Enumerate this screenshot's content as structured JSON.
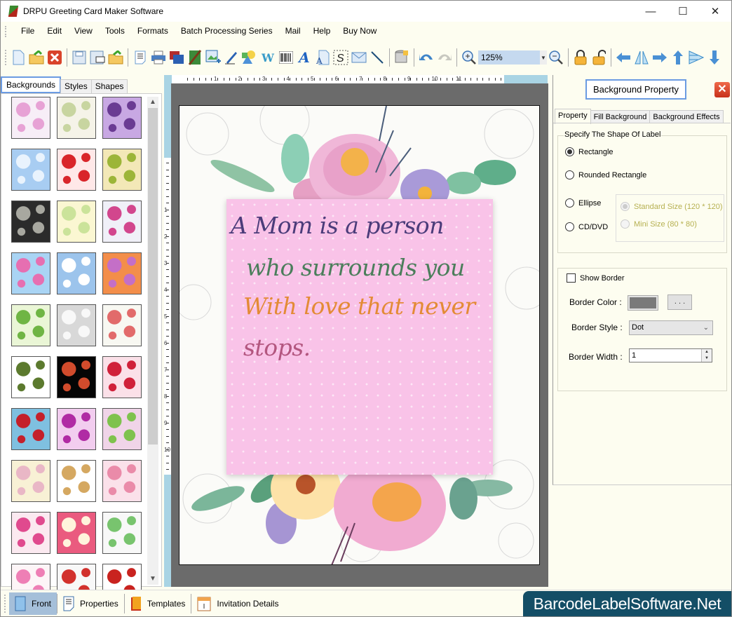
{
  "window": {
    "title": "DRPU Greeting Card Maker Software",
    "controls": {
      "minimize": "—",
      "maximize": "☐",
      "close": "✕"
    }
  },
  "menu": {
    "items": [
      "File",
      "Edit",
      "View",
      "Tools",
      "Formats",
      "Batch Processing Series",
      "Mail",
      "Help",
      "Buy Now"
    ]
  },
  "toolbar": {
    "zoom_value": "125%",
    "icons": [
      "new-icon",
      "open-icon",
      "close-file-icon",
      "save-icon",
      "save-as-icon",
      "export-icon",
      "properties-icon",
      "print-icon",
      "copy-pages-icon",
      "card-icon",
      "insert-image-icon",
      "pen-icon",
      "shapes-icon",
      "word-art-icon",
      "barcode-icon",
      "text-icon",
      "text-file-icon",
      "signature-icon",
      "mail-icon",
      "line-icon",
      "database-icon",
      "undo-icon",
      "redo-icon",
      "zoom-in-icon",
      "zoom-out-icon",
      "lock-icon",
      "unlock-icon",
      "arrow-left-icon",
      "flip-icon",
      "arrow-right-icon",
      "arrow-up-icon",
      "align-icon",
      "arrow-down-icon"
    ]
  },
  "left_panel": {
    "tabs": [
      {
        "label": "Backgrounds",
        "active": true
      },
      {
        "label": "Styles",
        "active": false
      },
      {
        "label": "Shapes",
        "active": false
      }
    ],
    "thumbnails": [
      {
        "name": "baby-items",
        "colors": [
          "#f7eef7",
          "#e7a2d5"
        ]
      },
      {
        "name": "baby-toys",
        "colors": [
          "#f5f3e8",
          "#c8d5a0"
        ]
      },
      {
        "name": "purple-flowers",
        "colors": [
          "#c8a8e3",
          "#6a3b93"
        ]
      },
      {
        "name": "clouds",
        "colors": [
          "#a8cdf2",
          "#e9f3fd"
        ]
      },
      {
        "name": "strawberries",
        "colors": [
          "#ffe8e8",
          "#d9252a"
        ]
      },
      {
        "name": "autumn-leaves",
        "colors": [
          "#f3e8b7",
          "#9cb538"
        ]
      },
      {
        "name": "black-roses",
        "colors": [
          "#2b2b2b",
          "#a8a8a0"
        ]
      },
      {
        "name": "pastel-pattern",
        "colors": [
          "#fbf7d2",
          "#cbe39a"
        ]
      },
      {
        "name": "gift-boxes",
        "colors": [
          "#f0f0f8",
          "#d2468d"
        ]
      },
      {
        "name": "colorful-flowers",
        "colors": [
          "#a9d4f4",
          "#e66fb1"
        ]
      },
      {
        "name": "snowflakes",
        "colors": [
          "#9cc4ec",
          "#ffffff"
        ]
      },
      {
        "name": "flower-mandala",
        "colors": [
          "#f38e4a",
          "#c46fc7"
        ]
      },
      {
        "name": "christmas-trees",
        "colors": [
          "#eaf6d6",
          "#6fb544"
        ]
      },
      {
        "name": "white-heart",
        "colors": [
          "#d8d8d8",
          "#f8f8f8"
        ]
      },
      {
        "name": "doodles",
        "colors": [
          "#f8f8f2",
          "#e26b6b"
        ]
      },
      {
        "name": "green-hearts",
        "colors": [
          "#ffffff",
          "#5c7a2e"
        ]
      },
      {
        "name": "fireworks",
        "colors": [
          "#050505",
          "#d14b2c"
        ]
      },
      {
        "name": "red-hearts",
        "colors": [
          "#fbe0e8",
          "#d0213a"
        ]
      },
      {
        "name": "santa",
        "colors": [
          "#7fc0e0",
          "#c4202a"
        ]
      },
      {
        "name": "pink-balls",
        "colors": [
          "#f2cdef",
          "#b02ba4"
        ]
      },
      {
        "name": "butterflies",
        "colors": [
          "#f0d4e8",
          "#7ec24d"
        ]
      },
      {
        "name": "pastel-stripes",
        "colors": [
          "#f8f1d5",
          "#e9b7c6"
        ]
      },
      {
        "name": "teddy-bear",
        "colors": [
          "#ffffff",
          "#d5a861"
        ]
      },
      {
        "name": "pink-dress",
        "colors": [
          "#fbe1ea",
          "#ea8ba9"
        ]
      },
      {
        "name": "love-hearts",
        "colors": [
          "#fbe9f0",
          "#e04a8e"
        ]
      },
      {
        "name": "heart-frame",
        "colors": [
          "#ea5b7f",
          "#fff4dc"
        ]
      },
      {
        "name": "bunnies",
        "colors": [
          "#f8f8f8",
          "#78c46e"
        ]
      },
      {
        "name": "kids",
        "colors": [
          "#fdf5f7",
          "#ee7fb5"
        ]
      },
      {
        "name": "ribbon-hearts",
        "colors": [
          "#f8f8f8",
          "#d2312d"
        ]
      },
      {
        "name": "red-flower",
        "colors": [
          "#ffffff",
          "#c9231f"
        ]
      }
    ]
  },
  "ruler": {
    "horizontal_labels": [
      "1",
      "2",
      "3",
      "4",
      "5",
      "6",
      "7",
      "8",
      "9",
      "10",
      "11"
    ],
    "vertical_labels": [
      "1",
      "2",
      "3",
      "4",
      "5",
      "6",
      "7",
      "8",
      "9",
      "10"
    ]
  },
  "card": {
    "lines": [
      {
        "text": "A Mom is a person",
        "color": "#4b3c7a"
      },
      {
        "text": "who surrounds you",
        "color": "#4b7e5b"
      },
      {
        "text": "With love that never",
        "color": "#e38b35"
      },
      {
        "text": "stops.",
        "color": "#b3567f"
      }
    ]
  },
  "right_panel": {
    "title": "Background Property",
    "tabs": [
      {
        "label": "Property",
        "active": true
      },
      {
        "label": "Fill Background",
        "active": false
      },
      {
        "label": "Background Effects",
        "active": false
      }
    ],
    "shape_group": {
      "title": "Specify The Shape Of Label",
      "options": [
        {
          "label": "Rectangle",
          "selected": true
        },
        {
          "label": "Rounded Rectangle",
          "selected": false
        },
        {
          "label": "Ellipse",
          "selected": false
        },
        {
          "label": "CD/DVD",
          "selected": false
        }
      ],
      "size_options": [
        {
          "label": "Standard Size (120 * 120)",
          "selected": true,
          "disabled": true
        },
        {
          "label": "Mini Size (80 * 80)",
          "selected": false,
          "disabled": true
        }
      ]
    },
    "border_group": {
      "show_border_label": "Show Border",
      "show_border_checked": false,
      "color_label": "Border Color :",
      "color_value": "#7a7a7a",
      "browse_label": ". . .",
      "style_label": "Border Style :",
      "style_value": "Dot",
      "width_label": "Border Width :",
      "width_value": "1"
    }
  },
  "bottom_bar": {
    "buttons": [
      {
        "label": "Front",
        "active": true
      },
      {
        "label": "Properties",
        "active": false
      },
      {
        "label": "Templates",
        "active": false
      },
      {
        "label": "Invitation Details",
        "active": false
      }
    ],
    "brand": "BarcodeLabelSoftware.Net"
  }
}
